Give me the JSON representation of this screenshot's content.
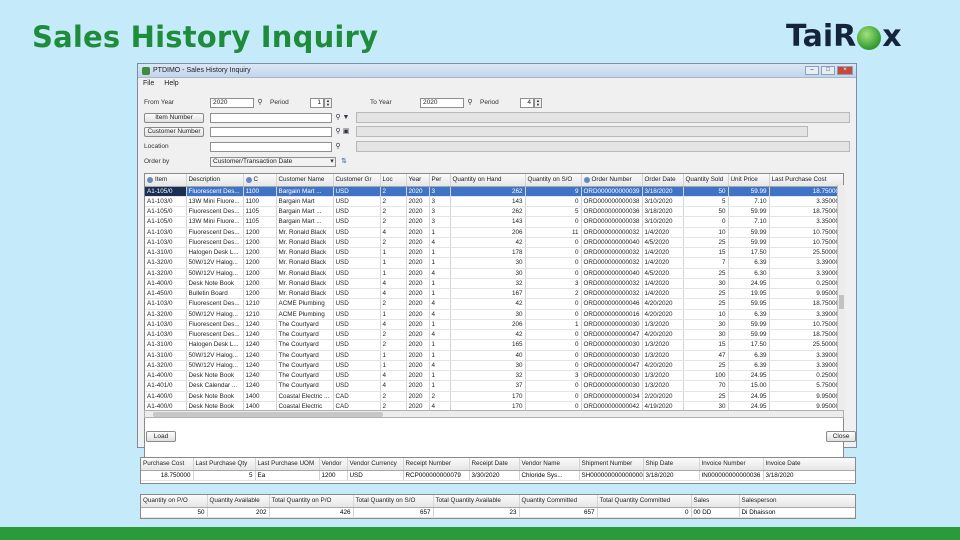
{
  "slide": {
    "title": "Sales History Inquiry",
    "logo_left": "Tai",
    "logo_right": "R",
    "logo_end": "x"
  },
  "window": {
    "title": "PTDIMO - Sales History Inquiry",
    "menu": [
      "File",
      "Help"
    ]
  },
  "form": {
    "from_year_label": "From Year",
    "from_year": "2020",
    "from_period_label": "Period",
    "from_period": "1",
    "to_year_label": "To Year",
    "to_year": "2020",
    "to_period_label": "Period",
    "to_period": "4",
    "item_number_button": "Item Number",
    "customer_number_button": "Customer Number",
    "location_label": "Location",
    "order_by_label": "Order by",
    "order_by_value": "Customer/Transaction Date"
  },
  "grid": {
    "columns": [
      "Item",
      "Description",
      "C",
      "Customer Name",
      "Customer Gr",
      "Loc",
      "Year",
      "Per",
      "Quantity on Hand",
      "Quantity on S/O",
      "Order Number",
      "Order Date",
      "Quantity Sold",
      "Unit Price",
      "Last Purchase Cost"
    ],
    "rows": [
      [
        "A1-105/0",
        "Fluorescent Des...",
        "1100",
        "Bargain Mart ...",
        "USD",
        "2",
        "2020",
        "3",
        "262",
        "9",
        "ORD000000000039",
        "3/18/2020",
        "50",
        "59.99",
        "18.750000"
      ],
      [
        "A1-103/0",
        "13W Mini Fluore...",
        "1100",
        "Bargain Mart",
        "USD",
        "2",
        "2020",
        "3",
        "143",
        "0",
        "ORD000000000038",
        "3/10/2020",
        "5",
        "7.10",
        "3.350000"
      ],
      [
        "A1-105/0",
        "Fluorescent Des...",
        "1105",
        "Bargain Mart ...",
        "USD",
        "2",
        "2020",
        "3",
        "262",
        "5",
        "ORD000000000036",
        "3/18/2020",
        "50",
        "59.99",
        "18.750000"
      ],
      [
        "A1-105/0",
        "13W Mini Fluore...",
        "1105",
        "Bargain Mart ...",
        "USD",
        "2",
        "2020",
        "3",
        "143",
        "0",
        "ORD000000000038",
        "3/10/2020",
        "0",
        "7.10",
        "3.350000"
      ],
      [
        "A1-103/0",
        "Fluorescent Des...",
        "1200",
        "Mr. Ronald Black",
        "USD",
        "4",
        "2020",
        "1",
        "206",
        "11",
        "ORD000000000032",
        "1/4/2020",
        "10",
        "59.99",
        "10.750000"
      ],
      [
        "A1-103/0",
        "Fluorescent Des...",
        "1200",
        "Mr. Ronald Black",
        "USD",
        "2",
        "2020",
        "4",
        "42",
        "0",
        "ORD000000000040",
        "4/5/2020",
        "25",
        "59.99",
        "10.750000"
      ],
      [
        "A1-310/0",
        "Halogen Desk L...",
        "1200",
        "Mr. Ronald Black",
        "USD",
        "1",
        "2020",
        "1",
        "178",
        "0",
        "ORD000000000032",
        "1/4/2020",
        "15",
        "17.50",
        "25.500000"
      ],
      [
        "A1-320/0",
        "50W/12V Halog...",
        "1200",
        "Mr. Ronald Black",
        "USD",
        "1",
        "2020",
        "1",
        "30",
        "0",
        "ORD000000000032",
        "1/4/2020",
        "7",
        "6.39",
        "3.390000"
      ],
      [
        "A1-320/0",
        "50W/12V Halog...",
        "1200",
        "Mr. Ronald Black",
        "USD",
        "1",
        "2020",
        "4",
        "30",
        "0",
        "ORD000000000040",
        "4/5/2020",
        "25",
        "6.30",
        "3.390000"
      ],
      [
        "A1-400/0",
        "Desk Note Book",
        "1200",
        "Mr. Ronald Black",
        "USD",
        "4",
        "2020",
        "1",
        "32",
        "3",
        "ORD000000000032",
        "1/4/2020",
        "30",
        "24.95",
        "0.250000"
      ],
      [
        "A1-450/0",
        "Bulletin Board",
        "1200",
        "Mr. Ronald Black",
        "USD",
        "4",
        "2020",
        "1",
        "167",
        "2",
        "ORD000000000032",
        "1/4/2020",
        "25",
        "19.95",
        "9.950000"
      ],
      [
        "A1-103/0",
        "Fluorescent Des...",
        "1210",
        "ACME Plumbing",
        "USD",
        "2",
        "2020",
        "4",
        "42",
        "0",
        "ORD000000000046",
        "4/20/2020",
        "25",
        "59.95",
        "18.750000"
      ],
      [
        "A1-320/0",
        "50W/12V Halog...",
        "1210",
        "ACME Plumbing",
        "USD",
        "1",
        "2020",
        "4",
        "30",
        "0",
        "ORD000000000016",
        "4/20/2020",
        "10",
        "6.39",
        "3.390000"
      ],
      [
        "A1-103/0",
        "Fluorescent Des...",
        "1240",
        "The Courtyard",
        "USD",
        "4",
        "2020",
        "1",
        "206",
        "1",
        "ORD000000000030",
        "1/3/2020",
        "30",
        "59.99",
        "10.750000"
      ],
      [
        "A1-103/0",
        "Fluorescent Des...",
        "1240",
        "The Courtyard",
        "USD",
        "2",
        "2020",
        "4",
        "42",
        "0",
        "ORD000000000047",
        "4/20/2020",
        "30",
        "59.99",
        "18.750000"
      ],
      [
        "A1-310/0",
        "Halogen Desk L...",
        "1240",
        "The Courtyard",
        "USD",
        "2",
        "2020",
        "1",
        "165",
        "0",
        "ORD000000000030",
        "1/3/2020",
        "15",
        "17.50",
        "25.500000"
      ],
      [
        "A1-310/0",
        "50W/12V Halog...",
        "1240",
        "The Courtyard",
        "USD",
        "1",
        "2020",
        "1",
        "40",
        "0",
        "ORD000000000030",
        "1/3/2020",
        "47",
        "6.39",
        "3.390000"
      ],
      [
        "A1-320/0",
        "50W/12V Halog...",
        "1240",
        "The Courtyard",
        "USD",
        "1",
        "2020",
        "4",
        "30",
        "0",
        "ORD000000000047",
        "4/20/2020",
        "25",
        "6.39",
        "3.390000"
      ],
      [
        "A1-400/0",
        "Desk Note Book",
        "1240",
        "The Courtyard",
        "USD",
        "4",
        "2020",
        "1",
        "32",
        "3",
        "ORD000000000030",
        "1/3/2020",
        "100",
        "24.95",
        "0.250000"
      ],
      [
        "A1-401/0",
        "Desk Calendar ...",
        "1240",
        "The Courtyard",
        "USD",
        "4",
        "2020",
        "1",
        "37",
        "0",
        "ORD000000000030",
        "1/3/2020",
        "70",
        "15.00",
        "5.750000"
      ],
      [
        "A1-400/0",
        "Desk Note Book",
        "1400",
        "Coastal Electric ...",
        "CAD",
        "2",
        "2020",
        "2",
        "170",
        "0",
        "ORD000000000034",
        "2/20/2020",
        "25",
        "24.95",
        "9.950000"
      ],
      [
        "A1-400/0",
        "Desk Note Book",
        "1400",
        "Coastal Electric",
        "CAD",
        "2",
        "2020",
        "4",
        "170",
        "0",
        "ORD000000000042",
        "4/19/2020",
        "30",
        "24.95",
        "9.950000"
      ]
    ]
  },
  "buttons": {
    "load": "Load",
    "close": "Close"
  },
  "details": {
    "columns": [
      "Purchase Cost",
      "Last Purchase Qty",
      "Last Purchase UOM",
      "Vendor",
      "Vendor Currency",
      "Receipt Number",
      "Receipt Date",
      "Vendor Name",
      "Shipment Number",
      "Ship Date",
      "Invoice Number",
      "Invoice Date"
    ],
    "row": [
      "18.750000",
      "5",
      "Ea",
      "1200",
      "USD",
      "RCP000000000079",
      "3/30/2020",
      "Chloride Sys...",
      "SH000000000000000",
      "3/18/2020",
      "IN000000000000036",
      "3/18/2020"
    ]
  },
  "totals": {
    "columns": [
      "Quantity on P/O",
      "Quantity Available",
      "Total Quantity on P/O",
      "Total Quantity on S/O",
      "Total Quantity Available",
      "Quantity Committed",
      "Total Quantity Committed",
      "Sales",
      "Salesperson"
    ],
    "row": [
      "50",
      "202",
      "426",
      "657",
      "23",
      "657",
      "0",
      "00  DD",
      "Di Dhaisson"
    ]
  },
  "colors": {
    "title_green": "#1f8c3b",
    "selection_blue": "#3d74c7",
    "bar_green": "#2a9a3a"
  }
}
